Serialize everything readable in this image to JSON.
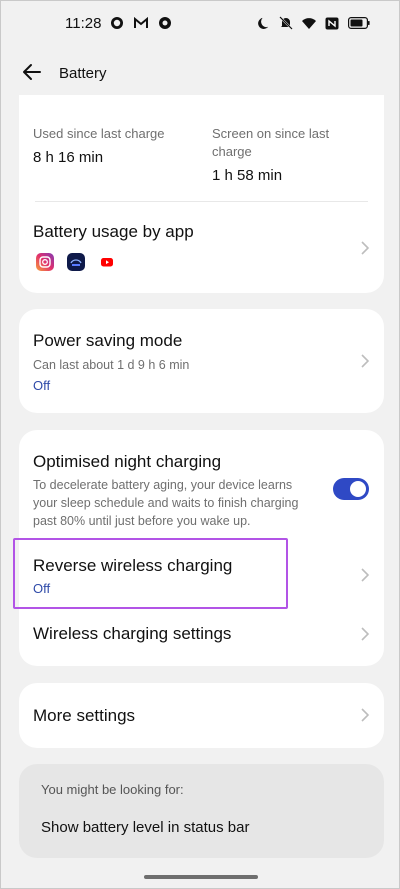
{
  "status_bar": {
    "time": "11:28",
    "left_icons": [
      "whatsapp-icon",
      "gmail-icon",
      "record-icon"
    ],
    "right_icons": [
      "moon-icon",
      "mute-bell-icon",
      "wifi-icon",
      "nfc-icon",
      "battery-icon"
    ]
  },
  "header": {
    "title": "Battery"
  },
  "usage": {
    "used_label": "Used since last charge",
    "used_value": "8 h 16 min",
    "screen_label_line1": "Screen on since last",
    "screen_label_line2": "charge",
    "screen_value": "1 h 58 min"
  },
  "battery_usage": {
    "title": "Battery usage by app",
    "apps": [
      "instagram-icon",
      "disney-hotstar-icon",
      "youtube-icon"
    ]
  },
  "power_saving": {
    "title": "Power saving mode",
    "subtitle": "Can last about 1 d 9 h 6 min",
    "status": "Off"
  },
  "night_charging": {
    "title": "Optimised night charging",
    "desc_line1": "To decelerate battery aging, your device learns",
    "desc_line2": "your sleep schedule and waits to finish charging",
    "desc_line3": "past 80% until just before you wake up.",
    "enabled": true
  },
  "reverse_wireless": {
    "title": "Reverse wireless charging",
    "status": "Off"
  },
  "wireless_settings": {
    "title": "Wireless charging settings"
  },
  "more_settings": {
    "title": "More settings"
  },
  "suggestions": {
    "label": "You might be looking for:",
    "item": "Show battery level in status bar"
  },
  "colors": {
    "accent": "#2f49c5",
    "status_text": "#2e4aa8",
    "highlight": "#b254e6",
    "background": "#f1f1f1"
  }
}
